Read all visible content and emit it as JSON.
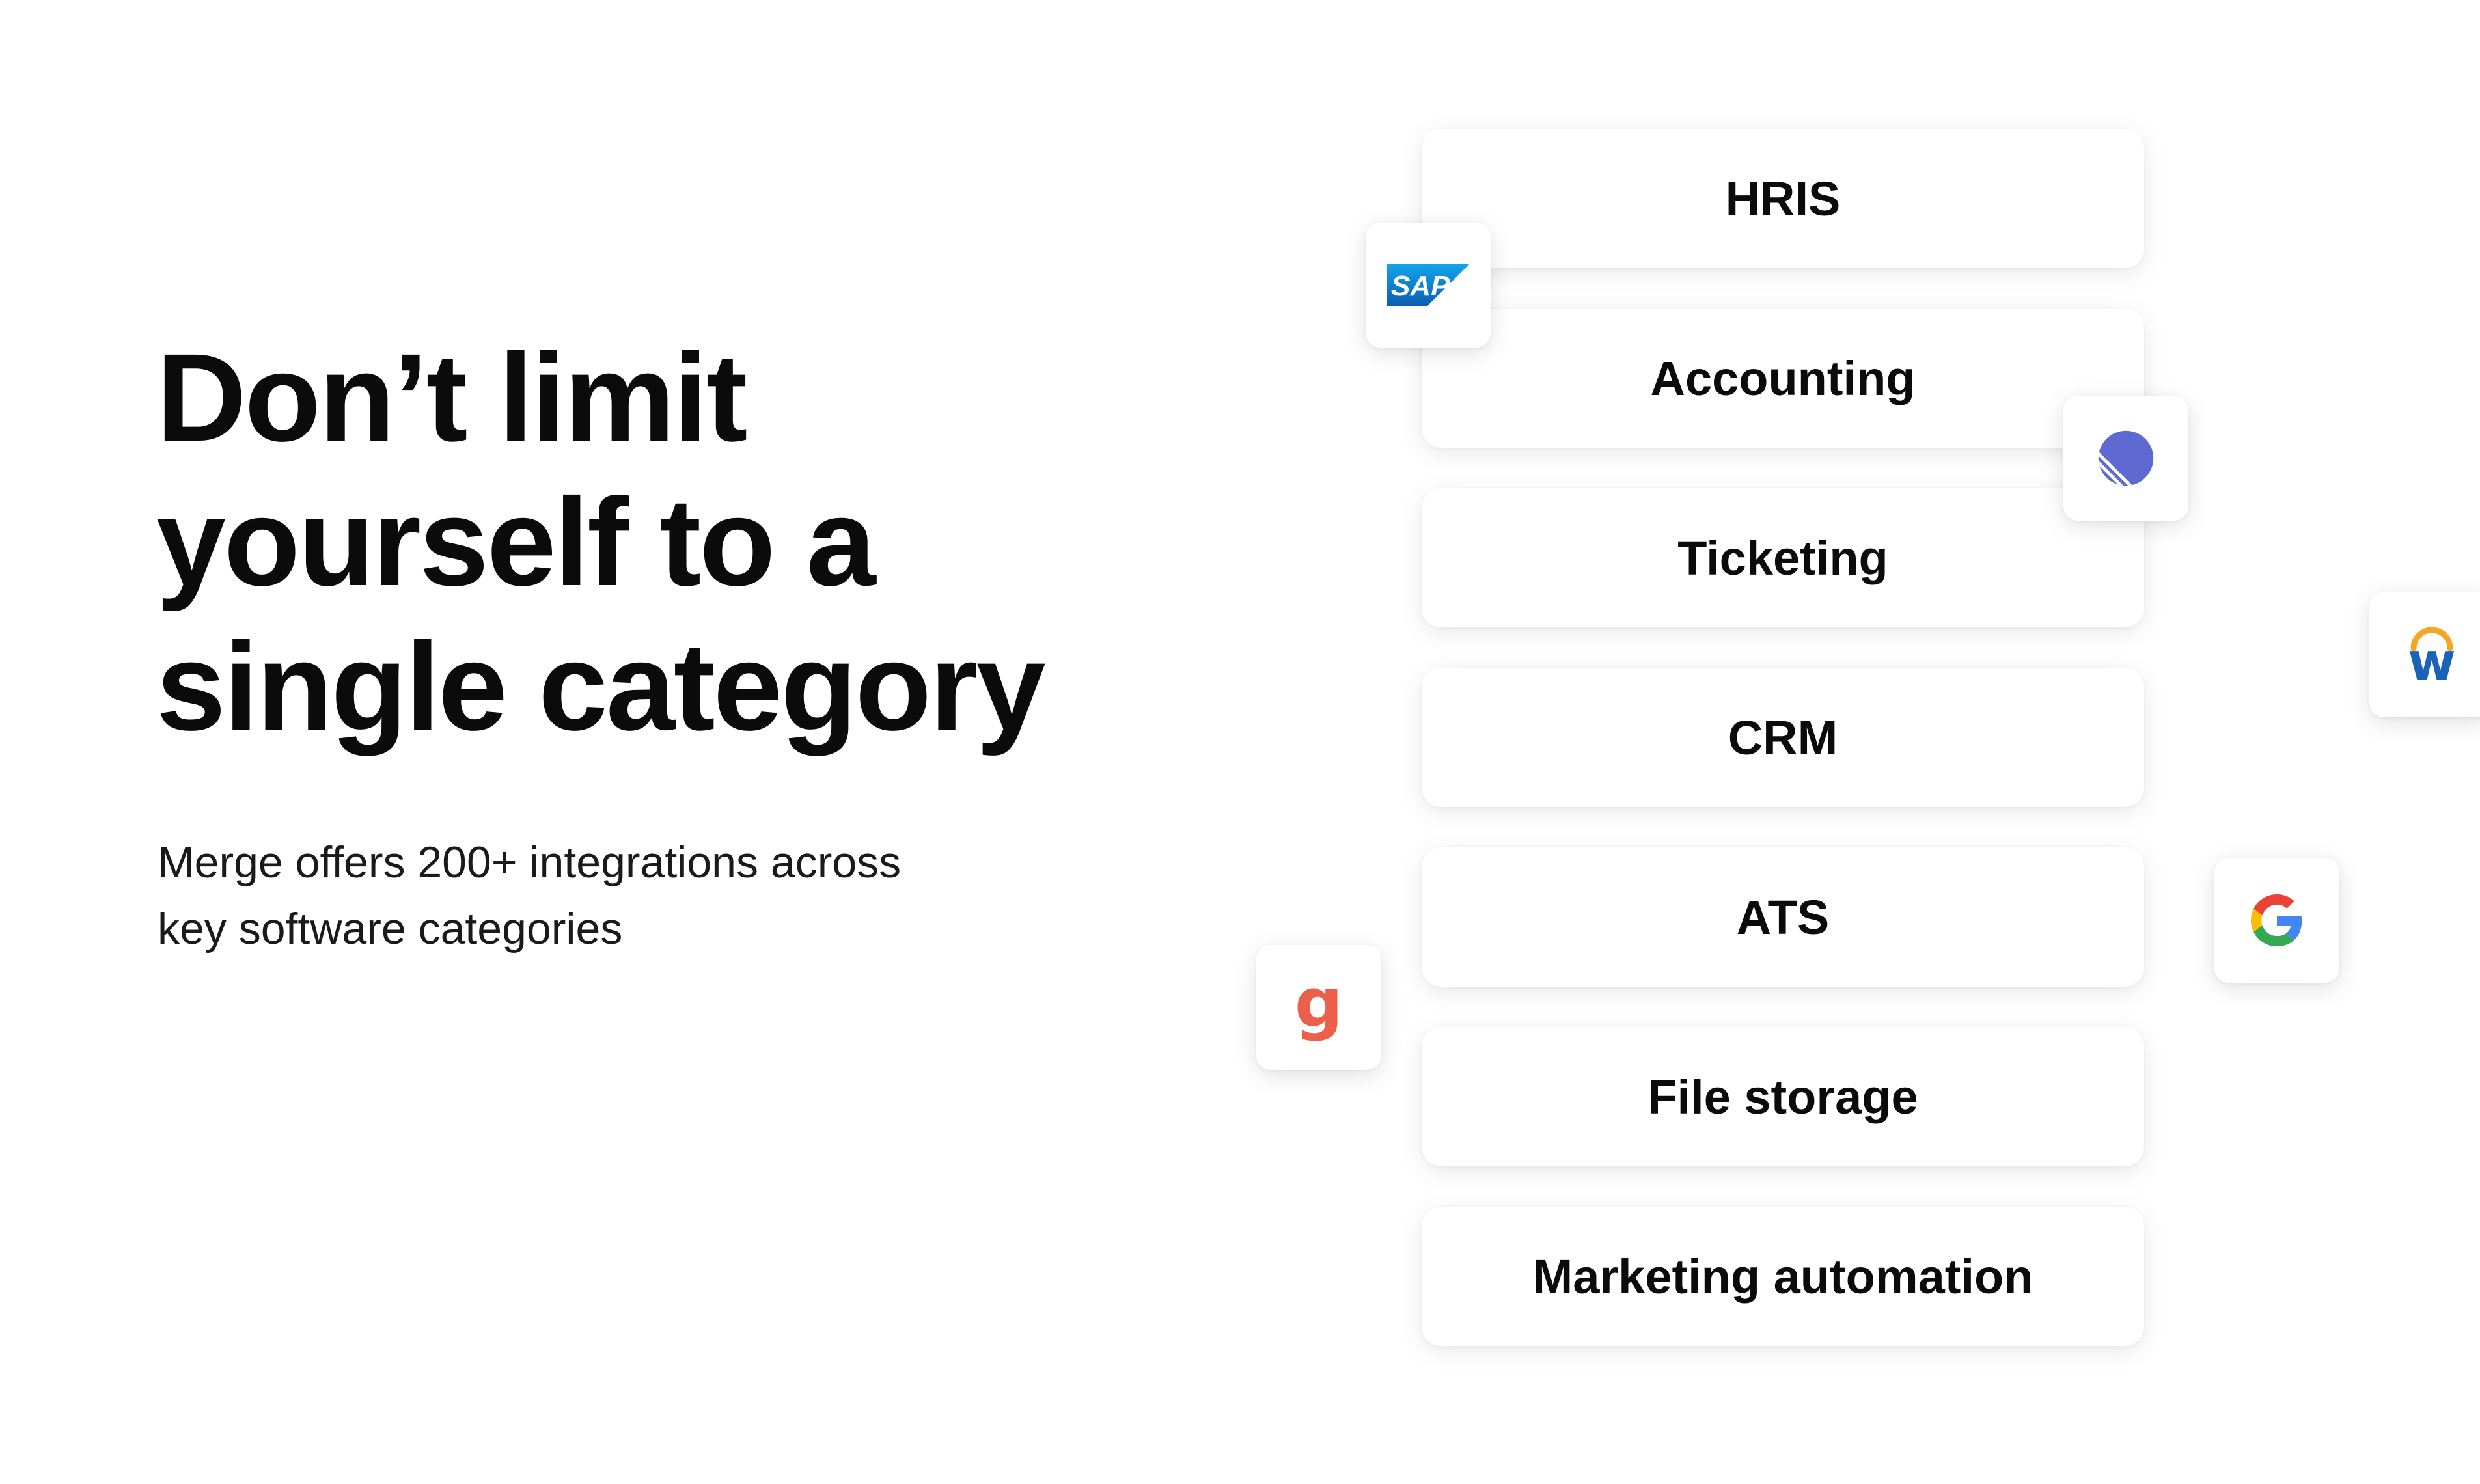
{
  "hero": {
    "headline_lines": [
      "Don’t limit",
      "yourself to a",
      "single category"
    ],
    "subtitle_lines": [
      "Merge offers 200+ integrations across",
      "key software categories"
    ]
  },
  "categories": [
    {
      "label": "HRIS"
    },
    {
      "label": "Accounting"
    },
    {
      "label": "Ticketing"
    },
    {
      "label": "CRM"
    },
    {
      "label": "ATS"
    },
    {
      "label": "File storage"
    },
    {
      "label": "Marketing automation"
    }
  ],
  "logos": [
    {
      "icon": "sap-logo-icon",
      "wordmark": "SAP",
      "color": "#0b6ec5"
    },
    {
      "icon": "linear-logo-icon",
      "color": "#5e6ad2"
    },
    {
      "icon": "workday-logo-icon",
      "letter": "w",
      "colors": [
        "#1a64b8",
        "#f5a623"
      ]
    },
    {
      "icon": "google-logo-icon",
      "colors": [
        "#4285f4",
        "#ea4335",
        "#fbbc05",
        "#34a853"
      ]
    },
    {
      "icon": "greenhouse-logo-icon",
      "letter": "g",
      "color": "#ec5f4b"
    }
  ]
}
